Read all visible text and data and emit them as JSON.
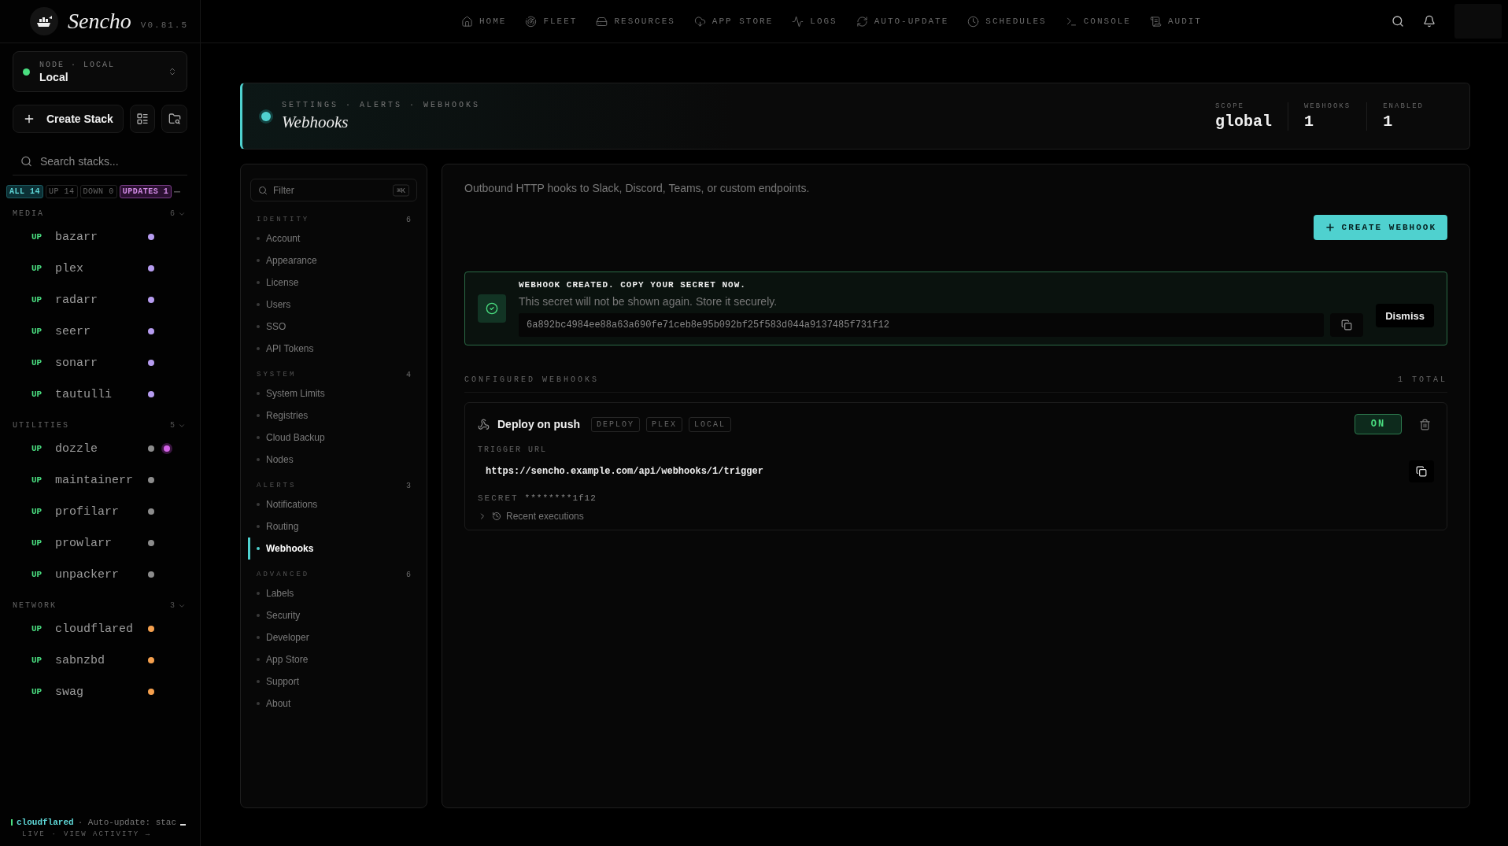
{
  "app": {
    "name": "Sencho",
    "version": "V0.81.5"
  },
  "nav": [
    {
      "label": "HOME"
    },
    {
      "label": "FLEET"
    },
    {
      "label": "RESOURCES"
    },
    {
      "label": "APP STORE"
    },
    {
      "label": "LOGS"
    },
    {
      "label": "AUTO-UPDATE"
    },
    {
      "label": "SCHEDULES"
    },
    {
      "label": "CONSOLE"
    },
    {
      "label": "AUDIT"
    }
  ],
  "sidebar": {
    "node": {
      "label": "NODE · LOCAL",
      "name": "Local",
      "online": true
    },
    "create_button": "Create Stack",
    "search": {
      "placeholder": "Search stacks..."
    },
    "filters": [
      {
        "label": "ALL",
        "count": "14",
        "selected": true,
        "kind": "normal"
      },
      {
        "label": "UP",
        "count": "14",
        "selected": false,
        "kind": "normal"
      },
      {
        "label": "DOWN",
        "count": "0",
        "selected": false,
        "kind": "normal"
      },
      {
        "label": "UPDATES",
        "count": "1",
        "selected": false,
        "kind": "updates"
      }
    ],
    "groups": [
      {
        "name": "MEDIA",
        "count": "6",
        "stacks": [
          {
            "status": "UP",
            "name": "bazarr",
            "dots": [
              {
                "color": "#b69cf0"
              }
            ]
          },
          {
            "status": "UP",
            "name": "plex",
            "dots": [
              {
                "color": "#b69cf0"
              }
            ]
          },
          {
            "status": "UP",
            "name": "radarr",
            "dots": [
              {
                "color": "#b69cf0"
              }
            ]
          },
          {
            "status": "UP",
            "name": "seerr",
            "dots": [
              {
                "color": "#b69cf0"
              }
            ]
          },
          {
            "status": "UP",
            "name": "sonarr",
            "dots": [
              {
                "color": "#b69cf0"
              }
            ]
          },
          {
            "status": "UP",
            "name": "tautulli",
            "dots": [
              {
                "color": "#b69cf0"
              }
            ]
          }
        ]
      },
      {
        "name": "UTILITIES",
        "count": "5",
        "stacks": [
          {
            "status": "UP",
            "name": "dozzle",
            "dots": [
              {
                "color": "#8c8c8c"
              },
              {
                "color": "#d263e6"
              }
            ]
          },
          {
            "status": "UP",
            "name": "maintainerr",
            "dots": [
              {
                "color": "#8c8c8c"
              }
            ]
          },
          {
            "status": "UP",
            "name": "profilarr",
            "dots": [
              {
                "color": "#8c8c8c"
              }
            ]
          },
          {
            "status": "UP",
            "name": "prowlarr",
            "dots": [
              {
                "color": "#8c8c8c"
              }
            ]
          },
          {
            "status": "UP",
            "name": "unpackerr",
            "dots": [
              {
                "color": "#8c8c8c"
              }
            ]
          }
        ]
      },
      {
        "name": "NETWORK",
        "count": "3",
        "stacks": [
          {
            "status": "UP",
            "name": "cloudflared",
            "dots": [
              {
                "color": "#f5a04e"
              }
            ]
          },
          {
            "status": "UP",
            "name": "sabnzbd",
            "dots": [
              {
                "color": "#f5a04e"
              }
            ]
          },
          {
            "status": "UP",
            "name": "swag",
            "dots": [
              {
                "color": "#f5a04e"
              }
            ]
          }
        ]
      }
    ],
    "footer": {
      "stack": "cloudflared",
      "message": "· Auto-update: stac",
      "status": "LIVE",
      "separator": "·",
      "link": "VIEW ACTIVITY →"
    }
  },
  "header": {
    "breadcrumb": "SETTINGS · ALERTS · WEBHOOKS",
    "title": "Webhooks",
    "stats": [
      {
        "label": "SCOPE",
        "value": "global"
      },
      {
        "label": "WEBHOOKS",
        "value": "1"
      },
      {
        "label": "ENABLED",
        "value": "1"
      }
    ]
  },
  "settings_nav": {
    "filter": {
      "placeholder": "Filter",
      "shortcut": "⌘K"
    },
    "sections": [
      {
        "name": "IDENTITY",
        "count": "6",
        "items": [
          {
            "label": "Account",
            "selected": false
          },
          {
            "label": "Appearance",
            "selected": false
          },
          {
            "label": "License",
            "selected": false
          },
          {
            "label": "Users",
            "selected": false
          },
          {
            "label": "SSO",
            "selected": false
          },
          {
            "label": "API Tokens",
            "selected": false
          }
        ]
      },
      {
        "name": "SYSTEM",
        "count": "4",
        "items": [
          {
            "label": "System Limits",
            "selected": false
          },
          {
            "label": "Registries",
            "selected": false
          },
          {
            "label": "Cloud Backup",
            "selected": false
          },
          {
            "label": "Nodes",
            "selected": false
          }
        ]
      },
      {
        "name": "ALERTS",
        "count": "3",
        "items": [
          {
            "label": "Notifications",
            "selected": false
          },
          {
            "label": "Routing",
            "selected": false
          },
          {
            "label": "Webhooks",
            "selected": true
          }
        ]
      },
      {
        "name": "ADVANCED",
        "count": "6",
        "items": [
          {
            "label": "Labels",
            "selected": false
          },
          {
            "label": "Security",
            "selected": false
          },
          {
            "label": "Developer",
            "selected": false
          },
          {
            "label": "App Store",
            "selected": false
          },
          {
            "label": "Support",
            "selected": false
          },
          {
            "label": "About",
            "selected": false
          }
        ]
      }
    ]
  },
  "content": {
    "description": "Outbound HTTP hooks to Slack, Discord, Teams, or custom endpoints.",
    "create_button": "CREATE WEBHOOK",
    "notice": {
      "title": "WEBHOOK CREATED. COPY YOUR SECRET NOW.",
      "text": "This secret will not be shown again. Store it securely.",
      "secret": "6a892bc4984ee88a63a690fe71ceb8e95b092bf25f583d044a9137485f731f12",
      "dismiss": "Dismiss"
    },
    "list_title": "CONFIGURED WEBHOOKS",
    "total": "1 TOTAL",
    "webhooks": [
      {
        "name": "Deploy on push",
        "tags": [
          "DEPLOY",
          "PLEX",
          "LOCAL"
        ],
        "toggle": "ON",
        "on": true,
        "url_label": "TRIGGER URL",
        "url": "https://sencho.example.com/api/webhooks/1/trigger",
        "secret_label": "SECRET",
        "secret": "********1f12",
        "executions": "Recent executions",
        "expanded": false
      }
    ]
  }
}
